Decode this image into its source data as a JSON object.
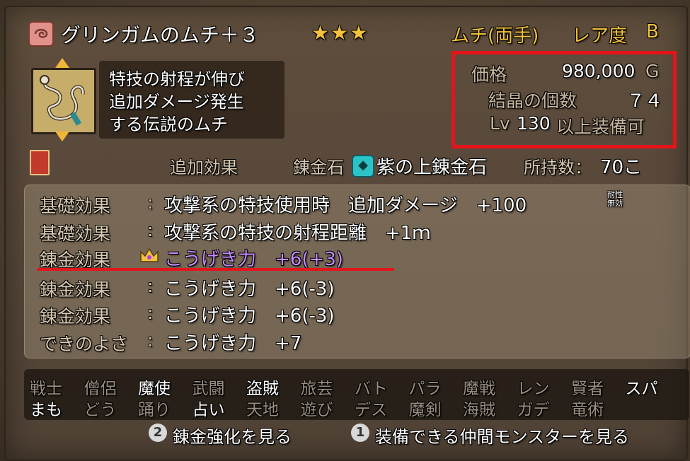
{
  "header": {
    "item_name": "グリンガムのムチ＋３",
    "stars": "★★★",
    "type_label": "ムチ(両手)",
    "rarity_label": "レア度",
    "rarity_grade": "B"
  },
  "item": {
    "description": [
      "特技の射程が伸び",
      "追加ダメージ発生",
      "する伝説のムチ"
    ]
  },
  "stats": {
    "price_label": "価格",
    "price_value": "980,000",
    "price_unit": "G",
    "crystal_label": "結晶の個数",
    "crystal_value": "７４",
    "level_prefix": "Lv",
    "level_value": "130",
    "level_suffix": "以上装備可"
  },
  "alchemy": {
    "extra_effect_label": "追加効果",
    "stone_label": "錬金石",
    "stone_name": "紫の上錬金石",
    "owned_label": "所持数：",
    "owned_value": "70こ"
  },
  "effects": [
    {
      "label": "基礎効果",
      "text": "攻撃系の特技使用時　追加ダメージ　+100",
      "suffix": "耐性無効"
    },
    {
      "label": "基礎効果",
      "text": "攻撃系の特技の射程距離　+1ｍ"
    },
    {
      "label": "錬金効果",
      "text": "こうげき力　+6(+3)"
    },
    {
      "label": "錬金効果",
      "text": "こうげき力　+6(-3)"
    },
    {
      "label": "錬金効果",
      "text": "こうげき力　+6(-3)"
    },
    {
      "label": "できのよさ",
      "text": "こうげき力　+7"
    }
  ],
  "jobs": {
    "row1": [
      "戦士",
      "僧侶",
      "魔使",
      "武闘",
      "盗賊",
      "旅芸",
      "バト",
      "パラ",
      "魔戦",
      "レン",
      "賢者",
      "スパ"
    ],
    "row2": [
      "まも",
      "どう",
      "踊り",
      "占い",
      "天地",
      "遊び",
      "デス",
      "魔剣",
      "海賊",
      "ガデ",
      "竜術"
    ],
    "row1_enabled": [
      false,
      false,
      true,
      false,
      true,
      false,
      false,
      false,
      false,
      false,
      false,
      true
    ],
    "row2_enabled": [
      true,
      false,
      false,
      true,
      false,
      false,
      false,
      false,
      false,
      false,
      false
    ]
  },
  "buttons": {
    "enhance_key": "2",
    "enhance_label": "錬金強化を見る",
    "monsters_key": "1",
    "monsters_label": "装備できる仲間モンスターを見る"
  },
  "colors": {
    "highlight_box": "#e3141a",
    "effect_purple": "#c58bff",
    "gold": "#f3c23b"
  }
}
